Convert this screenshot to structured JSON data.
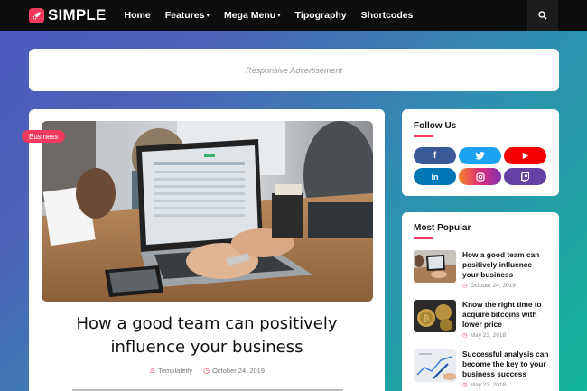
{
  "brand": {
    "name": "SIMPLE",
    "accent": "#f23a5e"
  },
  "nav": [
    {
      "label": "Home",
      "has_dropdown": false
    },
    {
      "label": "Features",
      "has_dropdown": true
    },
    {
      "label": "Mega Menu",
      "has_dropdown": true
    },
    {
      "label": "Tipography",
      "has_dropdown": false
    },
    {
      "label": "Shortcodes",
      "has_dropdown": false
    }
  ],
  "ad": {
    "text": "Responsive Advertisement"
  },
  "post": {
    "badge": "Business",
    "title_line1": "How a good team can positively",
    "title_line2": "influence your business",
    "author": "Templateify",
    "date": "October 24, 2019"
  },
  "follow": {
    "title": "Follow Us",
    "networks": [
      {
        "icon": "facebook-icon",
        "glyph": "f",
        "color": "#3b5998"
      },
      {
        "icon": "twitter-icon",
        "glyph": "t",
        "color": "#1da1f2"
      },
      {
        "icon": "youtube-icon",
        "glyph": "▶",
        "color": "#f50000"
      },
      {
        "icon": "linkedin-icon",
        "glyph": "in",
        "color": "#0077b5"
      },
      {
        "icon": "instagram-icon",
        "glyph": "◎",
        "color": "#e1306c"
      },
      {
        "icon": "twitch-icon",
        "glyph": "◧",
        "color": "#6441a5"
      }
    ]
  },
  "popular": {
    "title": "Most Popular",
    "items": [
      {
        "title_l1": "How a good team can",
        "title_l2": "positively influence",
        "title_l3": "your business",
        "date": "October 24, 2019"
      },
      {
        "title_l1": "Know the right time to",
        "title_l2": "acquire bitcoins with",
        "title_l3": "lower price",
        "date": "May 23, 2018"
      },
      {
        "title_l1": "Successful analysis can",
        "title_l2": "become the key to your",
        "title_l3": "business success",
        "date": "May 23, 2018"
      }
    ]
  }
}
